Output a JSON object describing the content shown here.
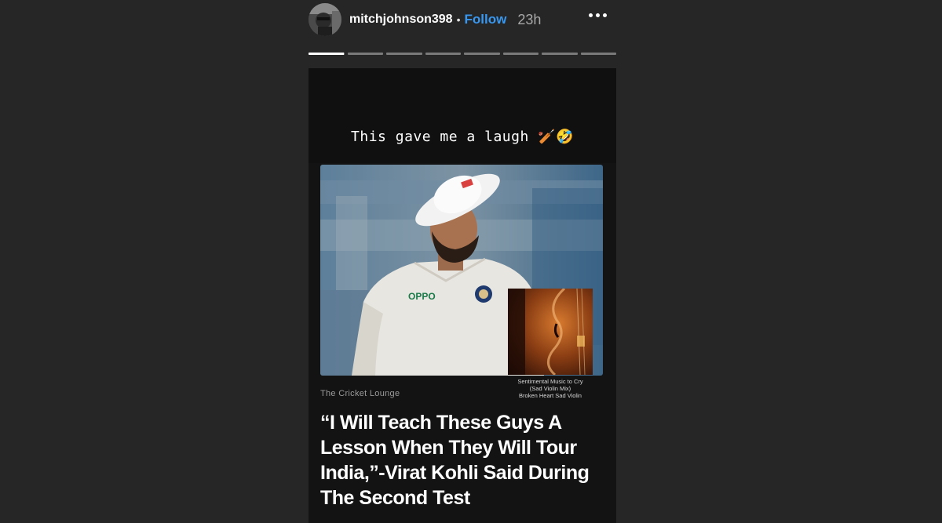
{
  "header": {
    "username": "mitchjohnson398",
    "separator": "•",
    "follow_label": "Follow",
    "timestamp": "23h",
    "more_icon": "more-horizontal-icon"
  },
  "progress": {
    "segments": 8,
    "current_index": 0,
    "current_fraction": 0.99
  },
  "story": {
    "caption_text": "This gave me a laugh ",
    "caption_emojis": "🏏🤣",
    "card": {
      "source": "The Cricket Lounge",
      "music_title_line1": "Sentimental Music to Cry",
      "music_title_line2": "(Sad Violin Mix)",
      "music_artist": "Broken Heart Sad Violin",
      "headline": "“I Will Teach These Guys A Lesson When They Will Tour India,”-Virat Kohli Said During The Second Test",
      "jersey_sponsor": "OPPO"
    }
  },
  "colors": {
    "background": "#262626",
    "follow": "#3897f0",
    "story_bg": "#121212"
  }
}
